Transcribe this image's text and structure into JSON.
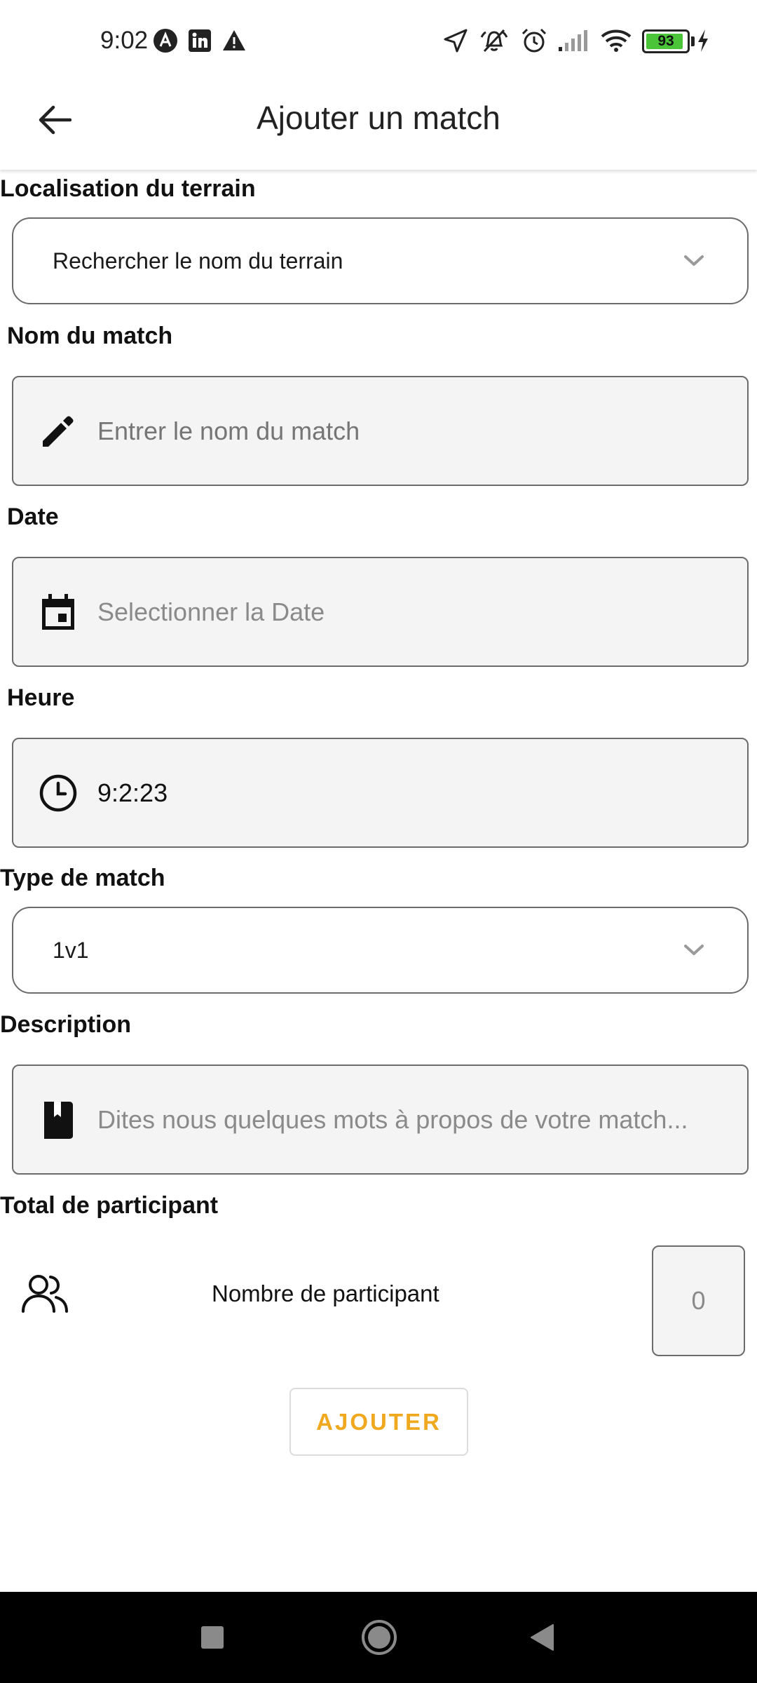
{
  "status_bar": {
    "time": "9:02",
    "battery_level": "93",
    "battery_fraction": 0.93,
    "icons": [
      "a-circle-icon",
      "linkedin-icon",
      "warning-icon",
      "location-arrow-icon",
      "mute-icon",
      "alarm-icon",
      "signal-icon",
      "wifi-icon",
      "battery-icon",
      "charging-bolt-icon"
    ]
  },
  "header": {
    "title": "Ajouter un match",
    "back_icon": "arrow-left-icon"
  },
  "form": {
    "location": {
      "label": "Localisation du terrain",
      "placeholder": "Rechercher le nom du terrain",
      "icon": "chevron-down-icon"
    },
    "match_name": {
      "label": "Nom du match",
      "placeholder": "Entrer le nom du match",
      "icon": "pencil-icon"
    },
    "date": {
      "label": "Date",
      "placeholder": "Selectionner la Date",
      "icon": "calendar-icon"
    },
    "time": {
      "label": "Heure",
      "value": "9:2:23",
      "icon": "clock-icon"
    },
    "match_type": {
      "label": "Type de match",
      "value": "1v1",
      "icon": "chevron-down-icon"
    },
    "description": {
      "label": "Description",
      "placeholder": "Dites nous quelques mots à propos de votre match...",
      "icon": "book-icon"
    },
    "participants": {
      "label": "Total de participant",
      "sub_label": "Nombre de participant",
      "placeholder": "0",
      "icon": "people-icon"
    }
  },
  "actions": {
    "submit_label": "AJOUTER"
  },
  "colors": {
    "accent": "#f0a81e",
    "field_background": "#f4f4f4",
    "border": "#6b6b6b",
    "battery_green": "#4cc43a",
    "nav_bar": "#000000"
  },
  "nav_bar": {
    "buttons": [
      "recents-square-icon",
      "home-circle-icon",
      "back-triangle-icon"
    ]
  }
}
